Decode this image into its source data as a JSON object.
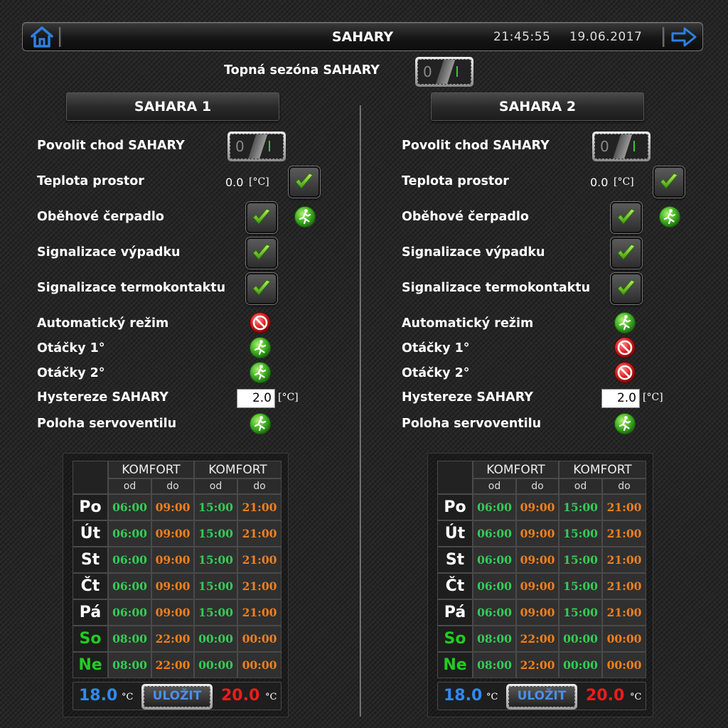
{
  "header": {
    "title": "SAHARY",
    "time": "21:45:55",
    "date": "19.06.2017",
    "home_icon": "home-icon",
    "next_icon": "arrow-right-icon"
  },
  "season": {
    "label": "Topná sezóna SAHARY",
    "toggle_off": "0",
    "toggle_on": "I"
  },
  "panels": [
    {
      "title": "SAHARA 1",
      "enable_label": "Povolit chod SAHARY",
      "temp_label": "Teplota prostor",
      "temp_value": "0.0",
      "temp_unit": "[°C]",
      "pump_label": "Oběhové čerpadlo",
      "fault_label": "Signalizace výpadku",
      "thermo_label": "Signalizace termokontaktu",
      "auto_label": "Automatický režim",
      "auto_state": "off",
      "speed1_label": "Otáčky 1°",
      "speed1_state": "on",
      "speed2_label": "Otáčky 2°",
      "speed2_state": "on",
      "hyst_label": "Hystereze SAHARY",
      "hyst_value": "2.0",
      "hyst_unit": "[°C]",
      "valve_label": "Poloha servoventilu",
      "valve_state": "on",
      "schedule": {
        "komfort1": "KOMFORT",
        "komfort2": "KOMFORT",
        "od": "od",
        "do": "do",
        "rows": [
          {
            "day": "Po",
            "t1": "06:00",
            "t2": "09:00",
            "t3": "15:00",
            "t4": "21:00",
            "weekend": false
          },
          {
            "day": "Út",
            "t1": "06:00",
            "t2": "09:00",
            "t3": "15:00",
            "t4": "21:00",
            "weekend": false
          },
          {
            "day": "St",
            "t1": "06:00",
            "t2": "09:00",
            "t3": "15:00",
            "t4": "21:00",
            "weekend": false
          },
          {
            "day": "Čt",
            "t1": "06:00",
            "t2": "09:00",
            "t3": "15:00",
            "t4": "21:00",
            "weekend": false
          },
          {
            "day": "Pá",
            "t1": "06:00",
            "t2": "09:00",
            "t3": "15:00",
            "t4": "21:00",
            "weekend": false
          },
          {
            "day": "So",
            "t1": "08:00",
            "t2": "22:00",
            "t3": "00:00",
            "t4": "00:00",
            "weekend": true
          },
          {
            "day": "Ne",
            "t1": "08:00",
            "t2": "22:00",
            "t3": "00:00",
            "t4": "00:00",
            "weekend": true
          }
        ],
        "temp_low": "18.0",
        "temp_high": "20.0",
        "temp_unit": "°C",
        "save_label": "ULOŽIT"
      }
    },
    {
      "title": "SAHARA 2",
      "enable_label": "Povolit chod SAHARY",
      "temp_label": "Teplota prostor",
      "temp_value": "0.0",
      "temp_unit": "[°C]",
      "pump_label": "Oběhové čerpadlo",
      "fault_label": "Signalizace výpadku",
      "thermo_label": "Signalizace termokontaktu",
      "auto_label": "Automatický režim",
      "auto_state": "on",
      "speed1_label": "Otáčky 1°",
      "speed1_state": "off",
      "speed2_label": "Otáčky 2°",
      "speed2_state": "off",
      "hyst_label": "Hystereze SAHARY",
      "hyst_value": "2.0",
      "hyst_unit": "[°C]",
      "valve_label": "Poloha servoventilu",
      "valve_state": "on",
      "schedule": {
        "komfort1": "KOMFORT",
        "komfort2": "KOMFORT",
        "od": "od",
        "do": "do",
        "rows": [
          {
            "day": "Po",
            "t1": "06:00",
            "t2": "09:00",
            "t3": "15:00",
            "t4": "21:00",
            "weekend": false
          },
          {
            "day": "Út",
            "t1": "06:00",
            "t2": "09:00",
            "t3": "15:00",
            "t4": "21:00",
            "weekend": false
          },
          {
            "day": "St",
            "t1": "06:00",
            "t2": "09:00",
            "t3": "15:00",
            "t4": "21:00",
            "weekend": false
          },
          {
            "day": "Čt",
            "t1": "06:00",
            "t2": "09:00",
            "t3": "15:00",
            "t4": "21:00",
            "weekend": false
          },
          {
            "day": "Pá",
            "t1": "06:00",
            "t2": "09:00",
            "t3": "15:00",
            "t4": "21:00",
            "weekend": false
          },
          {
            "day": "So",
            "t1": "08:00",
            "t2": "22:00",
            "t3": "00:00",
            "t4": "00:00",
            "weekend": true
          },
          {
            "day": "Ne",
            "t1": "08:00",
            "t2": "22:00",
            "t3": "00:00",
            "t4": "00:00",
            "weekend": true
          }
        ],
        "temp_low": "18.0",
        "temp_high": "20.0",
        "temp_unit": "°C",
        "save_label": "ULOŽIT"
      }
    }
  ],
  "colors": {
    "status_on": "#3fbf2a",
    "status_off": "#d81e1e",
    "time_start": "#33cc55",
    "time_end": "#f0801e",
    "temp_low": "#2f8af0",
    "temp_high": "#ee1c1c",
    "accent_blue": "#2f7fe0"
  }
}
